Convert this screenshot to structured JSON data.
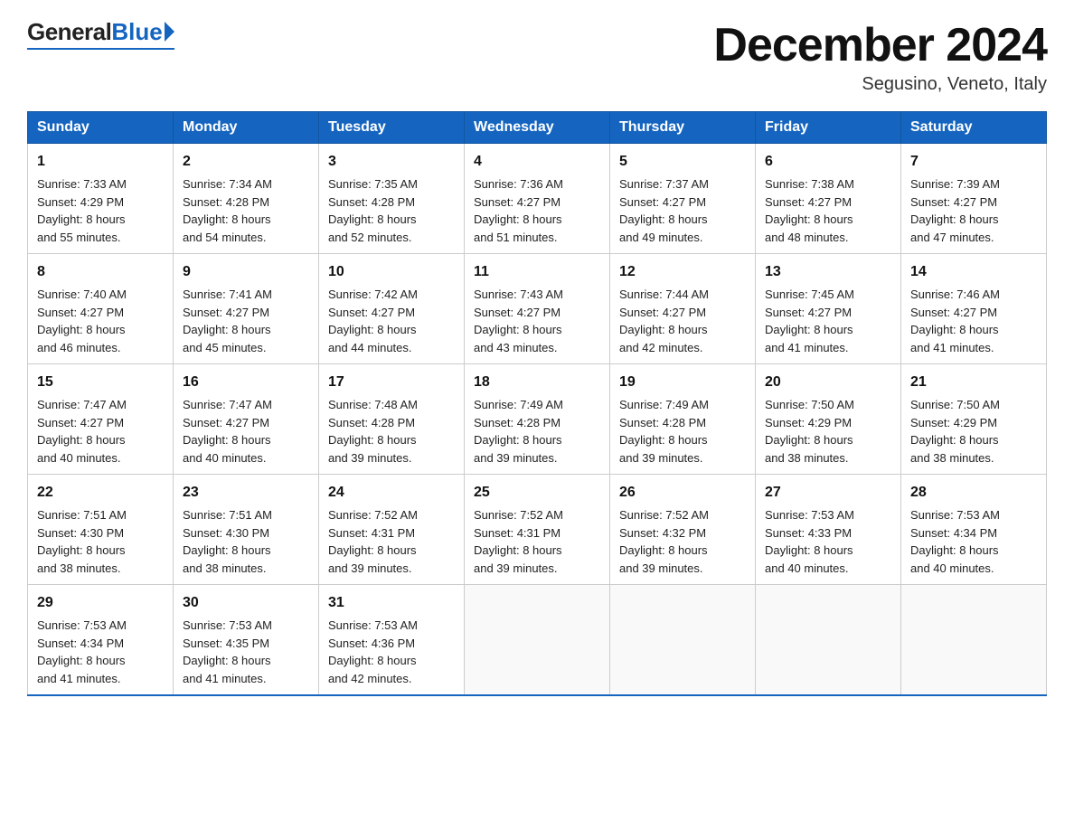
{
  "logo": {
    "general": "General",
    "blue": "Blue",
    "triangle": true
  },
  "header": {
    "month_year": "December 2024",
    "location": "Segusino, Veneto, Italy"
  },
  "days_of_week": [
    "Sunday",
    "Monday",
    "Tuesday",
    "Wednesday",
    "Thursday",
    "Friday",
    "Saturday"
  ],
  "weeks": [
    [
      {
        "day": "1",
        "sunrise": "7:33 AM",
        "sunset": "4:29 PM",
        "daylight": "8 hours and 55 minutes."
      },
      {
        "day": "2",
        "sunrise": "7:34 AM",
        "sunset": "4:28 PM",
        "daylight": "8 hours and 54 minutes."
      },
      {
        "day": "3",
        "sunrise": "7:35 AM",
        "sunset": "4:28 PM",
        "daylight": "8 hours and 52 minutes."
      },
      {
        "day": "4",
        "sunrise": "7:36 AM",
        "sunset": "4:27 PM",
        "daylight": "8 hours and 51 minutes."
      },
      {
        "day": "5",
        "sunrise": "7:37 AM",
        "sunset": "4:27 PM",
        "daylight": "8 hours and 49 minutes."
      },
      {
        "day": "6",
        "sunrise": "7:38 AM",
        "sunset": "4:27 PM",
        "daylight": "8 hours and 48 minutes."
      },
      {
        "day": "7",
        "sunrise": "7:39 AM",
        "sunset": "4:27 PM",
        "daylight": "8 hours and 47 minutes."
      }
    ],
    [
      {
        "day": "8",
        "sunrise": "7:40 AM",
        "sunset": "4:27 PM",
        "daylight": "8 hours and 46 minutes."
      },
      {
        "day": "9",
        "sunrise": "7:41 AM",
        "sunset": "4:27 PM",
        "daylight": "8 hours and 45 minutes."
      },
      {
        "day": "10",
        "sunrise": "7:42 AM",
        "sunset": "4:27 PM",
        "daylight": "8 hours and 44 minutes."
      },
      {
        "day": "11",
        "sunrise": "7:43 AM",
        "sunset": "4:27 PM",
        "daylight": "8 hours and 43 minutes."
      },
      {
        "day": "12",
        "sunrise": "7:44 AM",
        "sunset": "4:27 PM",
        "daylight": "8 hours and 42 minutes."
      },
      {
        "day": "13",
        "sunrise": "7:45 AM",
        "sunset": "4:27 PM",
        "daylight": "8 hours and 41 minutes."
      },
      {
        "day": "14",
        "sunrise": "7:46 AM",
        "sunset": "4:27 PM",
        "daylight": "8 hours and 41 minutes."
      }
    ],
    [
      {
        "day": "15",
        "sunrise": "7:47 AM",
        "sunset": "4:27 PM",
        "daylight": "8 hours and 40 minutes."
      },
      {
        "day": "16",
        "sunrise": "7:47 AM",
        "sunset": "4:27 PM",
        "daylight": "8 hours and 40 minutes."
      },
      {
        "day": "17",
        "sunrise": "7:48 AM",
        "sunset": "4:28 PM",
        "daylight": "8 hours and 39 minutes."
      },
      {
        "day": "18",
        "sunrise": "7:49 AM",
        "sunset": "4:28 PM",
        "daylight": "8 hours and 39 minutes."
      },
      {
        "day": "19",
        "sunrise": "7:49 AM",
        "sunset": "4:28 PM",
        "daylight": "8 hours and 39 minutes."
      },
      {
        "day": "20",
        "sunrise": "7:50 AM",
        "sunset": "4:29 PM",
        "daylight": "8 hours and 38 minutes."
      },
      {
        "day": "21",
        "sunrise": "7:50 AM",
        "sunset": "4:29 PM",
        "daylight": "8 hours and 38 minutes."
      }
    ],
    [
      {
        "day": "22",
        "sunrise": "7:51 AM",
        "sunset": "4:30 PM",
        "daylight": "8 hours and 38 minutes."
      },
      {
        "day": "23",
        "sunrise": "7:51 AM",
        "sunset": "4:30 PM",
        "daylight": "8 hours and 38 minutes."
      },
      {
        "day": "24",
        "sunrise": "7:52 AM",
        "sunset": "4:31 PM",
        "daylight": "8 hours and 39 minutes."
      },
      {
        "day": "25",
        "sunrise": "7:52 AM",
        "sunset": "4:31 PM",
        "daylight": "8 hours and 39 minutes."
      },
      {
        "day": "26",
        "sunrise": "7:52 AM",
        "sunset": "4:32 PM",
        "daylight": "8 hours and 39 minutes."
      },
      {
        "day": "27",
        "sunrise": "7:53 AM",
        "sunset": "4:33 PM",
        "daylight": "8 hours and 40 minutes."
      },
      {
        "day": "28",
        "sunrise": "7:53 AM",
        "sunset": "4:34 PM",
        "daylight": "8 hours and 40 minutes."
      }
    ],
    [
      {
        "day": "29",
        "sunrise": "7:53 AM",
        "sunset": "4:34 PM",
        "daylight": "8 hours and 41 minutes."
      },
      {
        "day": "30",
        "sunrise": "7:53 AM",
        "sunset": "4:35 PM",
        "daylight": "8 hours and 41 minutes."
      },
      {
        "day": "31",
        "sunrise": "7:53 AM",
        "sunset": "4:36 PM",
        "daylight": "8 hours and 42 minutes."
      },
      null,
      null,
      null,
      null
    ]
  ],
  "labels": {
    "sunrise": "Sunrise:",
    "sunset": "Sunset:",
    "daylight": "Daylight:"
  }
}
